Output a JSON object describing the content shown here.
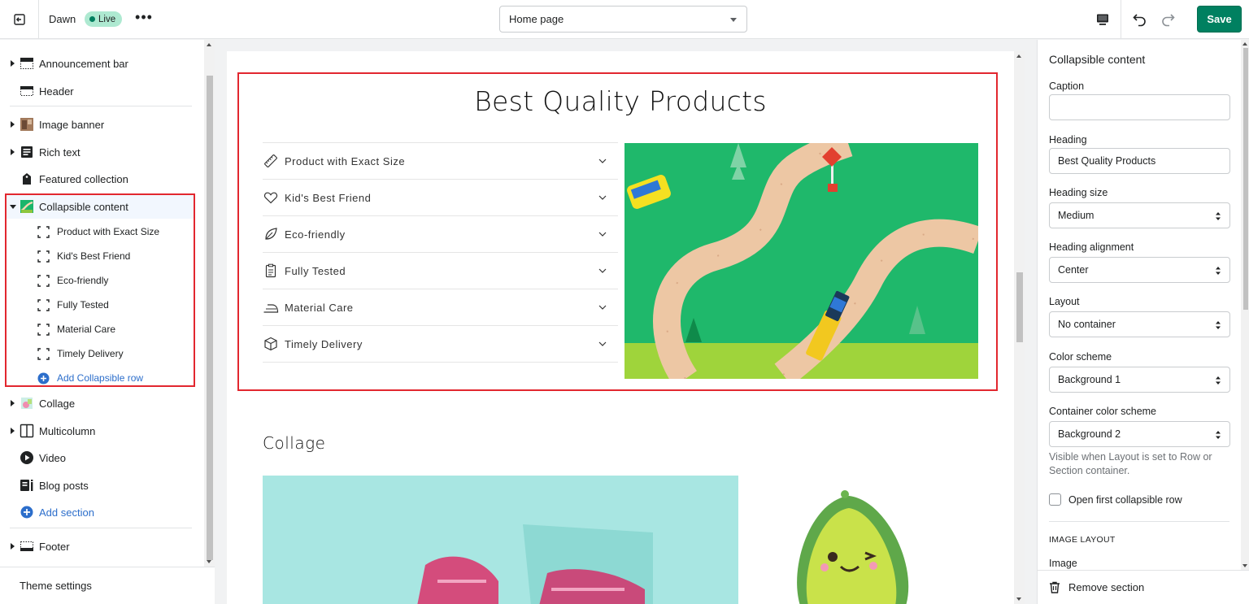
{
  "topbar": {
    "theme_name": "Dawn",
    "live_badge": "Live",
    "more_label": "•••",
    "page_select": "Home page",
    "save_label": "Save"
  },
  "sidebar": {
    "items": [
      {
        "label": "Announcement bar"
      },
      {
        "label": "Header"
      },
      {
        "label": "Image banner"
      },
      {
        "label": "Rich text"
      },
      {
        "label": "Featured collection"
      },
      {
        "label": "Collapsible content"
      },
      {
        "label": "Collage"
      },
      {
        "label": "Multicolumn"
      },
      {
        "label": "Video"
      },
      {
        "label": "Blog posts"
      },
      {
        "label": "Footer"
      }
    ],
    "sub_items": [
      {
        "label": "Product with Exact Size"
      },
      {
        "label": "Kid's Best Friend"
      },
      {
        "label": "Eco-friendly"
      },
      {
        "label": "Fully Tested"
      },
      {
        "label": "Material Care"
      },
      {
        "label": "Timely Delivery"
      }
    ],
    "add_row_label": "Add Collapsible row",
    "add_section_label": "Add section",
    "theme_settings_label": "Theme settings"
  },
  "preview": {
    "heading": "Best Quality Products",
    "rows": [
      {
        "label": "Product with Exact Size",
        "icon": "ruler-icon"
      },
      {
        "label": "Kid's Best Friend",
        "icon": "heart-icon"
      },
      {
        "label": "Eco-friendly",
        "icon": "leaf-icon"
      },
      {
        "label": "Fully Tested",
        "icon": "clipboard-icon"
      },
      {
        "label": "Material Care",
        "icon": "iron-icon"
      },
      {
        "label": "Timely Delivery",
        "icon": "box-icon"
      }
    ],
    "collage_title": "Collage"
  },
  "settings": {
    "title": "Collapsible content",
    "caption_label": "Caption",
    "caption_value": "",
    "heading_label": "Heading",
    "heading_value": "Best Quality Products",
    "heading_size_label": "Heading size",
    "heading_size_value": "Medium",
    "heading_alignment_label": "Heading alignment",
    "heading_alignment_value": "Center",
    "layout_label": "Layout",
    "layout_value": "No container",
    "color_scheme_label": "Color scheme",
    "color_scheme_value": "Background 1",
    "container_color_label": "Container color scheme",
    "container_color_value": "Background 2",
    "help_text": "Visible when Layout is set to Row or Section container.",
    "open_first_label": "Open first collapsible row",
    "image_layout_caps": "IMAGE LAYOUT",
    "image_label": "Image",
    "remove_label": "Remove section"
  },
  "colors": {
    "accent_green": "#008060",
    "highlight_red": "#e2272f",
    "link_blue": "#2c6ecb"
  }
}
